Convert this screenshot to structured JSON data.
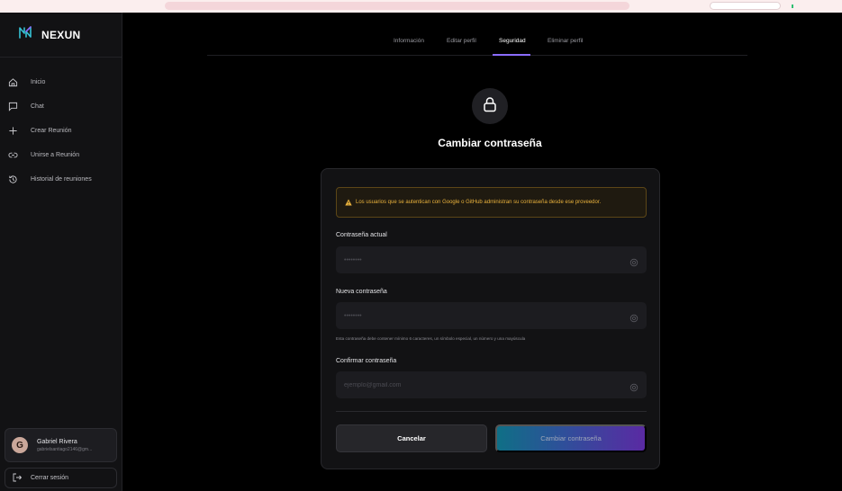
{
  "brand": {
    "name": "NEXUN"
  },
  "nav": [
    {
      "label": "Inicio",
      "icon": "home-icon"
    },
    {
      "label": "Chat",
      "icon": "chat-icon"
    },
    {
      "label": "Crear Reunión",
      "icon": "plus-icon"
    },
    {
      "label": "Unirse a Reunión",
      "icon": "link-icon"
    },
    {
      "label": "Historial de reuniones",
      "icon": "history-icon"
    }
  ],
  "user": {
    "initial": "G",
    "name": "Gabriel Rivera",
    "email": "gabrielsantiago2146@gm..."
  },
  "logout": {
    "label": "Cerrar sesión"
  },
  "tabs": [
    {
      "label": "Información",
      "active": false
    },
    {
      "label": "Editar perfil",
      "active": false
    },
    {
      "label": "Seguridad",
      "active": true
    },
    {
      "label": "Eliminar perfil",
      "active": false
    }
  ],
  "security": {
    "title": "Cambiar contraseña",
    "alert": "Los usuarios que se autentican con Google o GitHub administran su contraseña desde ese proveedor.",
    "current_label": "Contraseña actual",
    "current_placeholder": "••••••••",
    "new_label": "Nueva contraseña",
    "new_placeholder": "••••••••",
    "hint": "Esta contraseña debe contener mínimo 6 caracteres, un símbolo especial, un número y una mayúscula",
    "confirm_label": "Confirmar contraseña",
    "confirm_placeholder": "ejemplo@gmail.com",
    "cancel_label": "Cancelar",
    "submit_label": "Cambiar contraseña"
  },
  "colors": {
    "accent": "#8a6cff",
    "warning": "#eab23c",
    "background": "#000000",
    "sidebar": "#121214"
  }
}
